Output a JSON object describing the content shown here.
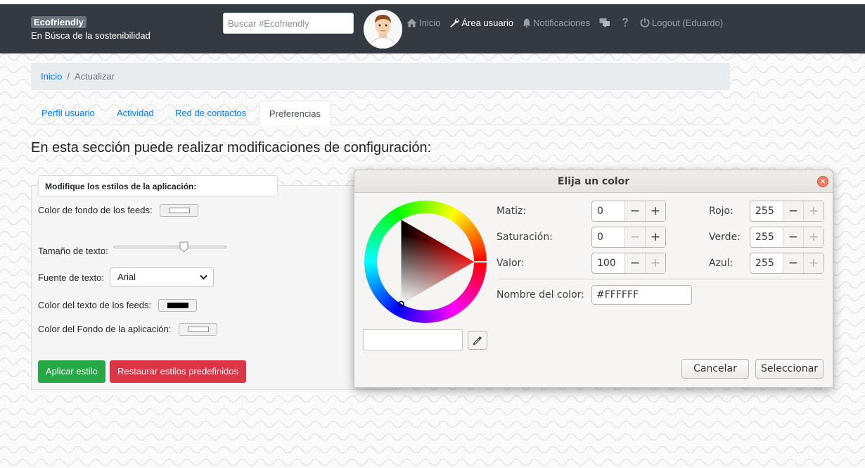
{
  "navbar": {
    "brand": "Ecofriendly",
    "tagline": "En Búsca de la sostenibilidad",
    "search_placeholder": "Buscar #Ecofriendly",
    "links": {
      "home": "Inicio",
      "user_area": "Área usuario",
      "notifications": "Notificaciones",
      "logout": "Logout (Eduardo)"
    },
    "colors": {
      "background": "#343a40",
      "link": "#9aa0a6",
      "active": "#ffffff"
    }
  },
  "breadcrumb": {
    "home": "Inicio",
    "separator": "/",
    "current": "Actualizar"
  },
  "tabs": [
    "Perfil usuario",
    "Actividad",
    "Red de contactos",
    "Preferencias"
  ],
  "active_tab": "Preferencias",
  "section_title": "En esta sección puede realizar modificaciones de configuración:",
  "styles_form": {
    "legend": "Modifique los estilos de la aplicación:",
    "feed_bg_label": "Color de fondo de los feeds:",
    "feed_bg_color": "#ffffff",
    "text_size_label": "Tamaño de texto:",
    "text_size_level": 0.62,
    "font_label": "Fuente de texto:",
    "font_value": "Arial",
    "feed_text_label": "Color del texto de los feeds:",
    "feed_text_color": "#000000",
    "app_bg_label": "Color del Fondo de la aplicación:",
    "app_bg_color": "#ffffff",
    "apply_button": "Aplicar estilo",
    "reset_button": "Restaurar estilos predefinidos",
    "colors": {
      "apply": "#28a745",
      "reset": "#dc3545"
    }
  },
  "color_dialog": {
    "title": "Elija un color",
    "hue_label": "Matiz:",
    "hue_value": "0",
    "saturation_label": "Saturación:",
    "saturation_value": "0",
    "value_label": "Valor:",
    "value_value": "100",
    "red_label": "Rojo:",
    "red_value": "255",
    "green_label": "Verde:",
    "green_value": "255",
    "blue_label": "Azul:",
    "blue_value": "255",
    "minus": "−",
    "plus": "+",
    "color_name_label": "Nombre del color:",
    "color_name_value": "#FFFFFF",
    "cancel_button": "Cancelar",
    "select_button": "Seleccionar",
    "close_glyph": "×"
  }
}
